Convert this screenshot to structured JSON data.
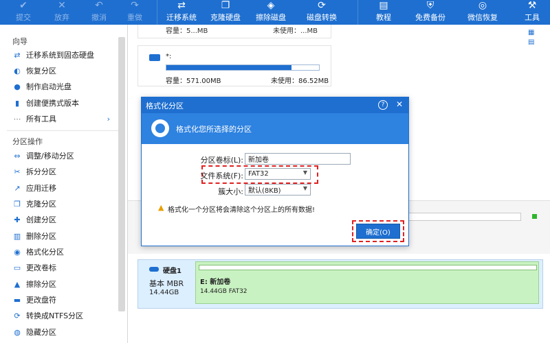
{
  "toolbar": {
    "buttons": [
      {
        "label": "提交",
        "icon": "check-icon"
      },
      {
        "label": "放弃",
        "icon": "close-icon"
      },
      {
        "label": "撤消",
        "icon": "undo-icon"
      },
      {
        "label": "重做",
        "icon": "redo-icon"
      },
      {
        "label": "迁移系统",
        "icon": "migrate-icon"
      },
      {
        "label": "克隆硬盘",
        "icon": "clone-icon"
      },
      {
        "label": "擦除磁盘",
        "icon": "eraser-icon"
      },
      {
        "label": "磁盘转换",
        "icon": "convert-icon"
      },
      {
        "label": "教程",
        "icon": "book-icon"
      },
      {
        "label": "免费备份",
        "icon": "backup-icon"
      },
      {
        "label": "微信恢复",
        "icon": "wechat-icon"
      },
      {
        "label": "工具",
        "icon": "tools-icon"
      }
    ]
  },
  "sidebar": {
    "wizard_title": "向导",
    "wizard_items": [
      "迁移系统到固态硬盘",
      "恢复分区",
      "制作启动光盘",
      "创建便携式版本",
      "所有工具"
    ],
    "ops_title": "分区操作",
    "ops_items": [
      "调整/移动分区",
      "拆分分区",
      "应用迁移",
      "克隆分区",
      "创建分区",
      "删除分区",
      "格式化分区",
      "更改卷标",
      "擦除分区",
      "更改盘符",
      "转换成NTFS分区",
      "隐藏分区"
    ]
  },
  "top_card": {
    "capacity_cut": "容量：5...MB",
    "unused_cut": "未使用：...MB"
  },
  "partition_card": {
    "name": "*:",
    "capacity": "容量：571.00MB",
    "unused": "未使用：86.52MB",
    "usage_fraction": 0.82
  },
  "dialog": {
    "title": "格式化分区",
    "help": "?",
    "close": "✕",
    "header": "格式化您所选择的分区",
    "label_volume": "分区卷标(L):",
    "value_volume": "新加卷",
    "label_fs": "文件系统(F):",
    "value_fs": "FAT32",
    "label_cluster": "簇大小:",
    "value_cluster": "默认(8KB)",
    "warning": "格式化一个分区将会清除这个分区上的所有数据!",
    "ok": "确定(O)"
  },
  "disk": {
    "name": "硬盘1",
    "type": "基本 MBR",
    "size": "14.44GB",
    "part_label": "E: 新加卷",
    "part_info": "14.44GB FAT32"
  }
}
